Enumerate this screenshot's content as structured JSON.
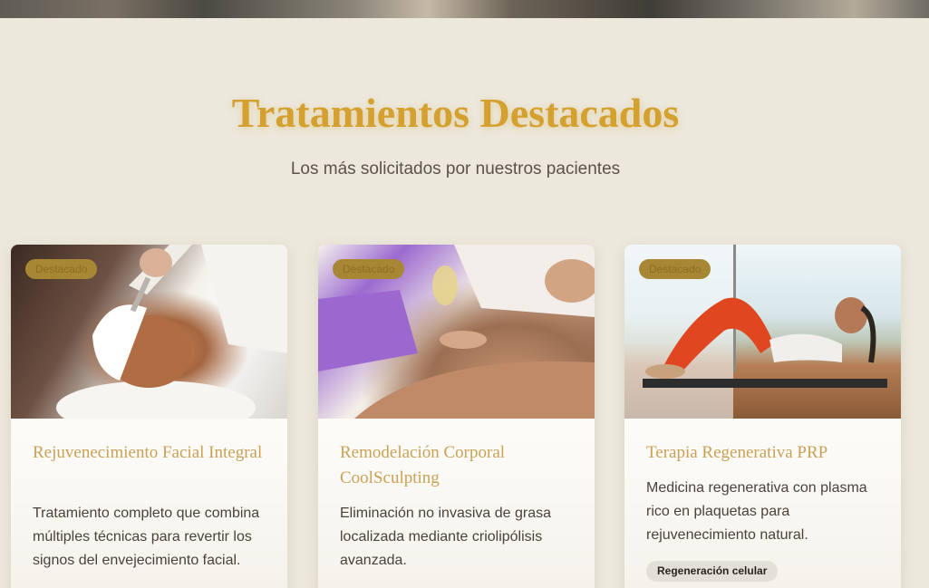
{
  "section": {
    "title": "Tratamientos Destacados",
    "subtitle": "Los más solicitados por nuestros pacientes"
  },
  "cards": [
    {
      "badge": "Destacado",
      "title": "Rejuvenecimiento Facial Integral",
      "description": "Tratamiento completo que combina múltiples técnicas para revertir los signos del envejecimiento facial.",
      "tags": []
    },
    {
      "badge": "Destacado",
      "title": "Remodelación Corporal CoolSculpting",
      "description": "Eliminación no invasiva de grasa localizada mediante criolipólisis avanzada.",
      "tags": []
    },
    {
      "badge": "Destacado",
      "title": "Terapia Regenerativa PRP",
      "description": "Medicina regenerativa con plasma rico en plaquetas para rejuvenecimiento natural.",
      "tags": [
        "Regeneración celular"
      ]
    }
  ],
  "colors": {
    "background": "#ece8dc",
    "accent_gold": "#d4a02f",
    "badge_gold": "#a88734",
    "card_title": "#c9a256"
  }
}
